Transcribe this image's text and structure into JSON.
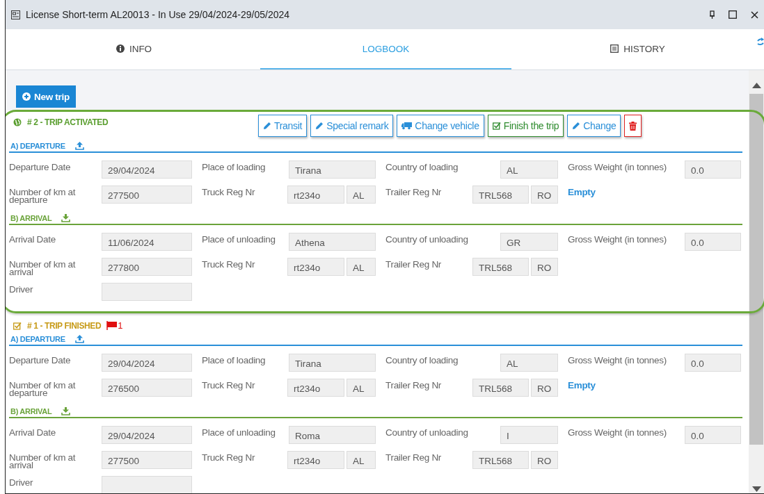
{
  "window": {
    "title": "License Short-term AL20013 - In Use 29/04/2024-29/05/2024"
  },
  "tabs": [
    {
      "label": "INFO",
      "kind": "info",
      "selected": false
    },
    {
      "label": "LOGBOOK",
      "kind": "plain",
      "selected": true
    },
    {
      "label": "HISTORY",
      "kind": "history",
      "selected": false
    }
  ],
  "new_trip_button": "New trip",
  "trips": [
    {
      "title": "# 2 - TRIP ACTIVATED",
      "kind": "active",
      "highlighted": true,
      "actions": [
        {
          "label": "Transit",
          "kind": "edit"
        },
        {
          "label": "Special remark",
          "kind": "edit"
        },
        {
          "label": "Change vehicle",
          "kind": "truck"
        },
        {
          "label": "Finish the trip",
          "kind": "finish"
        },
        {
          "label": "Change",
          "kind": "edit"
        },
        {
          "kind": "delete"
        }
      ],
      "sections": [
        {
          "heading": "A) DEPARTURE",
          "kind": "departure",
          "rows": [
            [
              {
                "kind": "input",
                "label": "Departure Date",
                "value": "29/04/2024"
              },
              {
                "kind": "input",
                "label": "Place of loading",
                "value": "Tirana"
              },
              {
                "kind": "input",
                "label": "Country of loading",
                "value": "AL"
              },
              {
                "kind": "input",
                "label": "Gross Weight (in tonnes)",
                "value": "0.0"
              }
            ],
            [
              {
                "kind": "input",
                "label": "Number of km at departure",
                "value": "277500"
              },
              {
                "kind": "pair",
                "label": "Truck Reg Nr",
                "value": "rt234o",
                "code": "AL"
              },
              {
                "kind": "pair",
                "label": "Trailer Reg Nr",
                "value": "TRL568",
                "code": "RO"
              },
              {
                "kind": "link",
                "text": "Empty"
              }
            ]
          ]
        },
        {
          "heading": "B) ARRIVAL",
          "kind": "arrival",
          "rows": [
            [
              {
                "kind": "input",
                "label": "Arrival Date",
                "value": "11/06/2024"
              },
              {
                "kind": "input",
                "label": "Place of unloading",
                "value": "Athena"
              },
              {
                "kind": "input",
                "label": "Country of unloading",
                "value": "GR"
              },
              {
                "kind": "input",
                "label": "Gross Weight (in tonnes)",
                "value": "0.0"
              }
            ],
            [
              {
                "kind": "input",
                "label": "Number of km at arrival",
                "value": "277800"
              },
              {
                "kind": "pair",
                "label": "Truck Reg Nr",
                "value": "rt234o",
                "code": "AL"
              },
              {
                "kind": "pair",
                "label": "Trailer Reg Nr",
                "value": "TRL568",
                "code": "RO"
              }
            ],
            [
              {
                "kind": "input",
                "label": "Driver"
              }
            ]
          ]
        }
      ]
    },
    {
      "title": "# 1 - TRIP FINISHED",
      "kind": "finished",
      "highlighted": false,
      "flag": "1",
      "sections": [
        {
          "heading": "A) DEPARTURE",
          "kind": "departure",
          "rows": [
            [
              {
                "kind": "input",
                "label": "Departure Date",
                "value": "29/04/2024"
              },
              {
                "kind": "input",
                "label": "Place of loading",
                "value": "Tirana"
              },
              {
                "kind": "input",
                "label": "Country of loading",
                "value": "AL"
              },
              {
                "kind": "input",
                "label": "Gross Weight (in tonnes)",
                "value": "0.0"
              }
            ],
            [
              {
                "kind": "input",
                "label": "Number of km at departure",
                "value": "276500"
              },
              {
                "kind": "pair",
                "label": "Truck Reg Nr",
                "value": "rt234o",
                "code": "AL"
              },
              {
                "kind": "pair",
                "label": "Trailer Reg Nr",
                "value": "TRL568",
                "code": "RO"
              },
              {
                "kind": "link",
                "text": "Empty"
              }
            ]
          ]
        },
        {
          "heading": "B) ARRIVAL",
          "kind": "arrival",
          "rows": [
            [
              {
                "kind": "input",
                "label": "Arrival Date",
                "value": "29/04/2024"
              },
              {
                "kind": "input",
                "label": "Place of unloading",
                "value": "Roma"
              },
              {
                "kind": "input",
                "label": "Country of unloading",
                "value": "I"
              },
              {
                "kind": "input",
                "label": "Gross Weight (in tonnes)",
                "value": "0.0"
              }
            ],
            [
              {
                "kind": "input",
                "label": "Number of km at arrival",
                "value": "277500"
              },
              {
                "kind": "pair",
                "label": "Truck Reg Nr",
                "value": "rt234o",
                "code": "AL"
              },
              {
                "kind": "pair",
                "label": "Trailer Reg Nr",
                "value": "TRL568",
                "code": "RO"
              }
            ],
            [
              {
                "kind": "input",
                "label": "Driver"
              }
            ]
          ]
        }
      ]
    }
  ]
}
